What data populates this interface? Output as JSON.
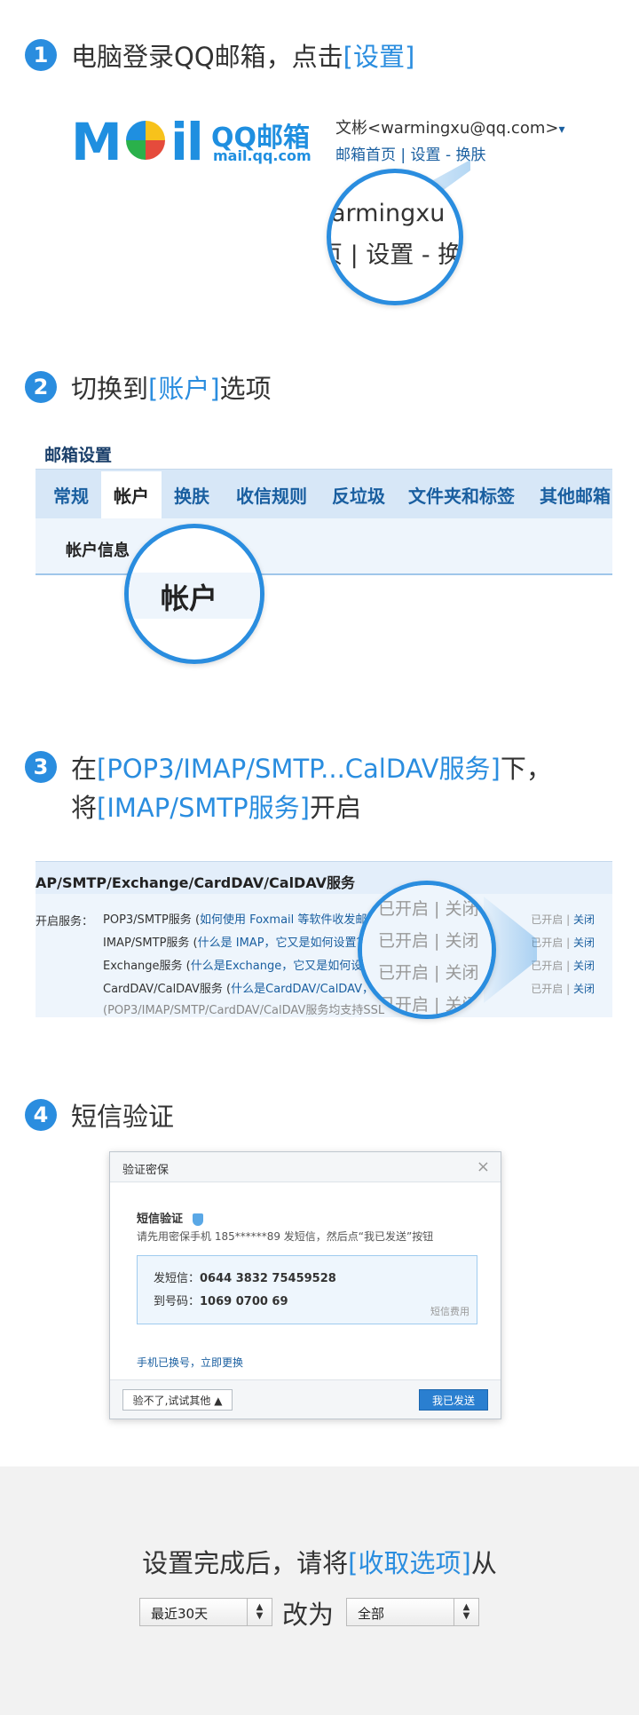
{
  "colors": {
    "accent": "#2a8ddf",
    "link": "#1a5fa0",
    "footer_bg": "#f2f2f2"
  },
  "step1": {
    "number": "1",
    "text": "电脑登录QQ邮箱，点击",
    "highlight": "[设置]",
    "logo_text": "M",
    "logo_text2": "il",
    "logo_cn": "QQ邮箱",
    "logo_domain": "mail.qq.com",
    "user_line": "文彬<warmingxu@qq.com>",
    "user_caret": "▾",
    "nav_line": "邮箱首页 | 设置 - 换肤",
    "zoom_line1": "armingxu",
    "zoom_line2": "页 | 设置 - 换"
  },
  "step2": {
    "number": "2",
    "text": "切换到",
    "highlight": "[账户]",
    "text_after": "选项",
    "panel_title": "邮箱设置",
    "tabs": [
      "常规",
      "帐户",
      "换肤",
      "收信规则",
      "反垃圾",
      "文件夹和标签",
      "其他邮箱"
    ],
    "sub_title": "帐户信息",
    "zoom_text": "帐户"
  },
  "step3": {
    "number": "3",
    "line1_text": "在",
    "line1_highlight": "[POP3/IMAP/SMTP...CalDAV服务]",
    "line1_after": "下，",
    "line2_text": "将",
    "line2_highlight": "[IMAP/SMTP服务]",
    "line2_after": "开启",
    "box_title": "AP/SMTP/Exchange/CardDAV/CalDAV服务",
    "label": "开启服务：",
    "services": [
      {
        "name": "POP3/SMTP服务 (",
        "link": "如何使用 Foxmail 等软件收发邮件"
      },
      {
        "name": "IMAP/SMTP服务 (",
        "link": "什么是 IMAP，它又是如何设置？"
      },
      {
        "name": "Exchange服务 (",
        "link": "什么是Exchange，它又是如何设置"
      },
      {
        "name": "CardDAV/CalDAV服务 (",
        "link": "什么是CardDAV/CalDAV，"
      }
    ],
    "note": "(POP3/IMAP/SMTP/CardDAV/CalDAV服务均支持SSL",
    "status_on": "已开启",
    "status_sep": "|",
    "status_off": "关闭",
    "zoom_rows": [
      "已开启 | 关闭",
      "已开启 | 关闭",
      "已开启 | 关闭",
      "已开启 | 关闭"
    ]
  },
  "step4": {
    "number": "4",
    "text": "短信验证",
    "dialog_title": "验证密保",
    "close": "×",
    "sms_heading": "短信验证",
    "sms_desc": "请先用密保手机 185******89 发短信，然后点“我已发送”按钮",
    "send_label": "发短信：",
    "send_value": "0644 3832 75459528",
    "to_label": "到号码：",
    "to_value": "1069 0700 69",
    "fee": "短信费用",
    "changed_phone": "手机已换号，立即更换",
    "btn_other": "验不了,试试其他 ▲",
    "btn_sent": "我已发送"
  },
  "footer": {
    "text": "设置完成后，请将",
    "highlight": "[收取选项]",
    "text_after": "从",
    "select_from": "最近30天",
    "change_to": "改为",
    "select_to": "全部"
  }
}
